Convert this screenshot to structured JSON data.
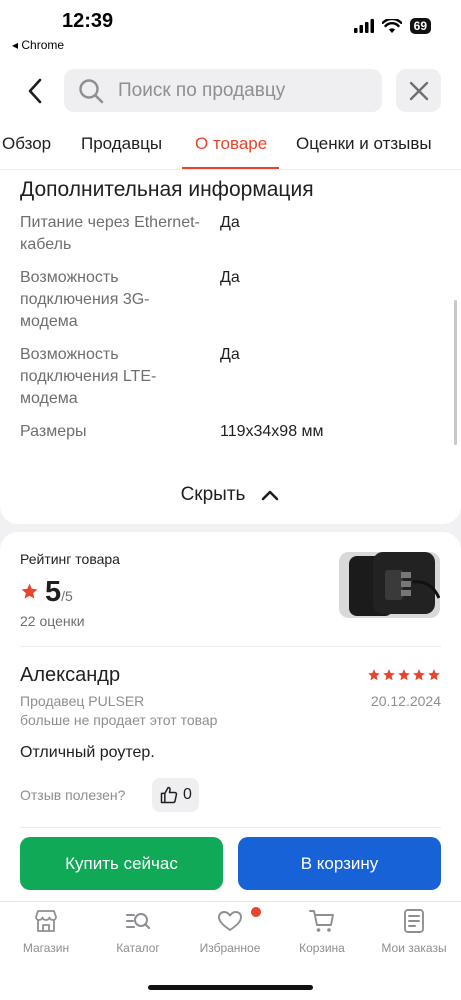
{
  "status": {
    "time": "12:39",
    "back_app": "◂ Chrome",
    "battery": "69"
  },
  "search": {
    "placeholder": "Поиск по продавцу"
  },
  "tabs": [
    {
      "label": "Обзор"
    },
    {
      "label": "Продавцы"
    },
    {
      "label": "О товаре"
    },
    {
      "label": "Оценки и отзывы"
    }
  ],
  "info": {
    "title": "Дополнительная информация",
    "specs": [
      {
        "label": "Питание через Ethernet-кабель",
        "value": "Да"
      },
      {
        "label": "Возможность подключения 3G-модема",
        "value": "Да"
      },
      {
        "label": "Возможность подключения LTE-модема",
        "value": "Да"
      },
      {
        "label": "Размеры",
        "value": "119x34x98 мм"
      }
    ],
    "hide_label": "Скрыть"
  },
  "rating": {
    "title": "Рейтинг товара",
    "value": "5",
    "max": "/5",
    "count": "22 оценки"
  },
  "review": {
    "author": "Александр",
    "stars": 5,
    "seller": "Продавец PULSER",
    "date": "20.12.2024",
    "seller_note": "больше не продает этот товар",
    "text": "Отличный роутер.",
    "helpful_label": "Отзыв полезен?",
    "likes": "0"
  },
  "actions": {
    "buy": "Купить сейчас",
    "cart": "В корзину"
  },
  "nav": [
    {
      "label": "Магазин",
      "icon": "store-icon"
    },
    {
      "label": "Каталог",
      "icon": "catalog-search-icon"
    },
    {
      "label": "Избранное",
      "icon": "heart-icon"
    },
    {
      "label": "Корзина",
      "icon": "cart-icon"
    },
    {
      "label": "Мои заказы",
      "icon": "orders-icon"
    }
  ],
  "colors": {
    "accent": "#e8452c",
    "buy": "#10a957",
    "cart": "#1662d6"
  }
}
